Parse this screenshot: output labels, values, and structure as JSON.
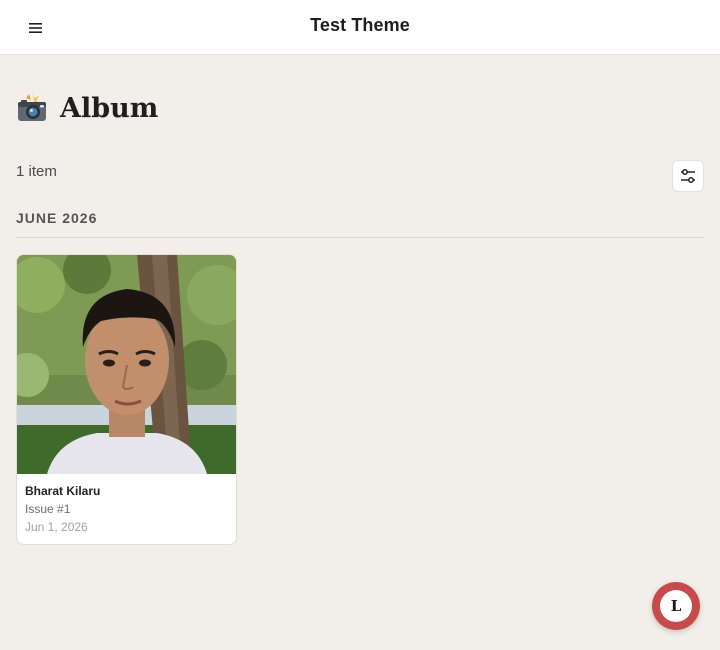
{
  "header": {
    "site_title": "Test Theme",
    "menu_icon": "hamburger-menu-icon"
  },
  "page": {
    "title": "Album",
    "title_icon": "camera-with-flash-icon",
    "item_count": "1 item",
    "filter_icon": "sliders-filter-icon"
  },
  "groups": [
    {
      "label": "JUNE 2026",
      "items": [
        {
          "name": "Bharat Kilaru",
          "issue": "Issue #1",
          "date": "Jun 1, 2026",
          "image": "portrait-photo"
        }
      ]
    }
  ],
  "floating_button": {
    "label": "L",
    "color": "#c84b4b"
  },
  "colors": {
    "background": "#f2eee9",
    "header_background": "#ffffff",
    "card_background": "#ffffff"
  }
}
